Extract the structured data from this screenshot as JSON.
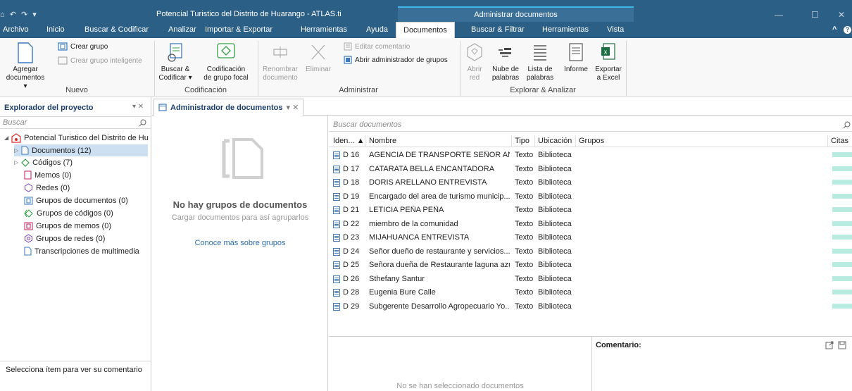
{
  "window": {
    "quick_access": "⌂ ↶ ↷ ▾",
    "title": "Potencial Turistico del Distrito de Huarango - ATLAS.ti",
    "context_title": "Administrar documentos",
    "minimize": "—",
    "maximize": "☐",
    "close": "✕"
  },
  "menu": {
    "items": [
      "Archivo",
      "Inicio",
      "Buscar & Codificar",
      "Analizar",
      "Importar & Exportar",
      "Herramientas",
      "Ayuda",
      "Documentos",
      "Buscar & Filtrar",
      "Herramientas",
      "Vista"
    ],
    "collapse": "^",
    "help": "?"
  },
  "ribbon": {
    "nuevo": {
      "label": "Nuevo",
      "agregar_1": "Agregar",
      "agregar_2": "documentos ▾",
      "crear_grupo": "Crear grupo",
      "crear_grupo_inteligente": "Crear grupo inteligente"
    },
    "codificacion": {
      "label": "Codificación",
      "buscar_1": "Buscar &",
      "buscar_2": "Codificar ▾",
      "focal_1": "Codificación",
      "focal_2": "de grupo focal"
    },
    "administrar": {
      "label": "Administrar",
      "renombrar_1": "Renombrar",
      "renombrar_2": "documento",
      "eliminar": "Eliminar",
      "editar_comentario": "Editar comentario",
      "abrir_admin": "Abrir administrador de grupos"
    },
    "explorar": {
      "label": "Explorar & Analizar",
      "abrir_1": "Abrir",
      "abrir_2": "red",
      "nube_1": "Nube de",
      "nube_2": "palabras",
      "lista_1": "Lista de",
      "lista_2": "palabras",
      "informe": "Informe",
      "exportar_1": "Exportar",
      "exportar_2": "a Excel"
    }
  },
  "explorer": {
    "title": "Explorador del proyecto",
    "pin": "▾ ✕",
    "search_placeholder": "Buscar",
    "root": "Potencial Turistico del Distrito de Hu",
    "items": [
      {
        "label": "Documentos (12)",
        "icon": "document-icon",
        "color": "#3b7bbf"
      },
      {
        "label": "Códigos (7)",
        "icon": "code-diamond-icon",
        "color": "#2f9e44"
      },
      {
        "label": "Memos (0)",
        "icon": "memo-icon",
        "color": "#c2185b"
      },
      {
        "label": "Redes (0)",
        "icon": "network-icon",
        "color": "#7b3fb4"
      },
      {
        "label": "Grupos de documentos (0)",
        "icon": "document-group-icon",
        "color": "#3b7bbf"
      },
      {
        "label": "Grupos de códigos (0)",
        "icon": "code-group-icon",
        "color": "#2f9e44"
      },
      {
        "label": "Grupos de memos (0)",
        "icon": "memo-group-icon",
        "color": "#c2185b"
      },
      {
        "label": "Grupos de redes (0)",
        "icon": "network-group-icon",
        "color": "#7b3fb4"
      },
      {
        "label": "Transcripciones de multimedia",
        "icon": "transcript-icon",
        "color": "#3b7bbf"
      }
    ],
    "footer": "Selecciona ítem para ver su comentario"
  },
  "doc_manager": {
    "tab_title": "Administrador de documentos",
    "tab_controls": "▾ ✕",
    "empty_title": "No hay grupos de documentos",
    "empty_sub": "Cargar documentos para así agruparlos",
    "learn_more": "Conoce más sobre grupos",
    "search_placeholder": "Buscar documentos",
    "columns": {
      "id": "Iden... ▲",
      "name": "Nombre",
      "type": "Tipo",
      "location": "Ubicación",
      "groups": "Grupos",
      "quotes": "Citas"
    },
    "rows": [
      {
        "id": "D 16",
        "name": "AGENCIA DE TRANSPORTE SEÑOR AN...",
        "type": "Texto",
        "location": "Biblioteca"
      },
      {
        "id": "D 17",
        "name": "CATARATA BELLA ENCANTADORA",
        "type": "Texto",
        "location": "Biblioteca"
      },
      {
        "id": "D 18",
        "name": "DORIS ARELLANO ENTREVISTA",
        "type": "Texto",
        "location": "Biblioteca"
      },
      {
        "id": "D 19",
        "name": "Encargado del area de turismo municip...",
        "type": "Texto",
        "location": "Biblioteca"
      },
      {
        "id": "D 21",
        "name": "LETICIA PEÑA PEÑA",
        "type": "Texto",
        "location": "Biblioteca"
      },
      {
        "id": "D 22",
        "name": "miembro de la comunidad",
        "type": "Texto",
        "location": "Biblioteca"
      },
      {
        "id": "D 23",
        "name": "MIJAHUANCA ENTREVISTA",
        "type": "Texto",
        "location": "Biblioteca"
      },
      {
        "id": "D 24",
        "name": "Señor dueño de restaurante y servicios...",
        "type": "Texto",
        "location": "Biblioteca"
      },
      {
        "id": "D 25",
        "name": "Señora dueña de Restaurante laguna azul",
        "type": "Texto",
        "location": "Biblioteca"
      },
      {
        "id": "D 26",
        "name": "Sthefany Santur",
        "type": "Texto",
        "location": "Biblioteca"
      },
      {
        "id": "D 28",
        "name": "Eugenia Bure Calle",
        "type": "Texto",
        "location": "Biblioteca"
      },
      {
        "id": "D 29",
        "name": "Subgerente Desarrollo Agropecuario Yo...",
        "type": "Texto",
        "location": "Biblioteca"
      }
    ],
    "comment_label": "Comentario:",
    "no_selection": "No se han seleccionado documentos"
  },
  "colors": {
    "title_bar": "#2c5f86",
    "accent": "#3fb5e8",
    "selection": "#cde0f2",
    "quote_bar": "#b9ece0",
    "link": "#2b6cb0"
  }
}
